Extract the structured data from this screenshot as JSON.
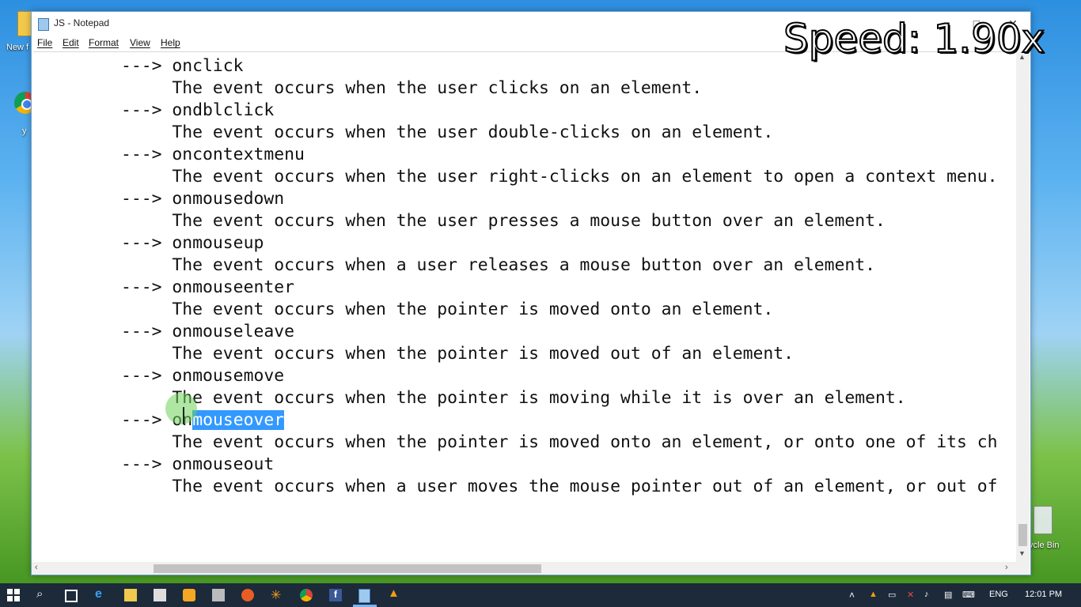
{
  "desktop": {
    "folder_label": "New f",
    "chrome_label": "y",
    "recycle_label": "ycle Bin"
  },
  "window": {
    "title": "JS - Notepad",
    "buttons": {
      "minimize": "–",
      "maximize": "□",
      "close": "✕"
    }
  },
  "menu": [
    "File",
    "Edit",
    "Format",
    "View",
    "Help"
  ],
  "editor": {
    "lines": [
      "        ---> onclick",
      "             The event occurs when the user clicks on an element.",
      "        ---> ondblclick",
      "             The event occurs when the user double-clicks on an element.",
      "        ---> oncontextmenu",
      "             The event occurs when the user right-clicks on an element to open a context menu.",
      "        ---> onmousedown",
      "             The event occurs when the user presses a mouse button over an element.",
      "        ---> onmouseup",
      "             The event occurs when a user releases a mouse button over an element.",
      "        ---> onmouseenter",
      "             The event occurs when the pointer is moved onto an element.",
      "        ---> onmouseleave",
      "             The event occurs when the pointer is moved out of an element.",
      "        ---> onmousemove",
      "             The event occurs when the pointer is moving while it is over an element.",
      "        ---> onmouseover",
      "             The event occurs when the pointer is moved onto an element, or onto one of its ch",
      "        ---> onmouseout",
      "             The event occurs when a user moves the mouse pointer out of an element, or out of"
    ],
    "selected_line": 16,
    "selected_prefix": "        ---> on",
    "selected_text": "mouseover"
  },
  "overlay": {
    "speed": "Speed: 1.90x"
  },
  "taskbar": {
    "language": "ENG",
    "time": "12:01 PM"
  },
  "colors": {
    "selection": "#3399ff",
    "taskbar": "#1c2a3a"
  }
}
